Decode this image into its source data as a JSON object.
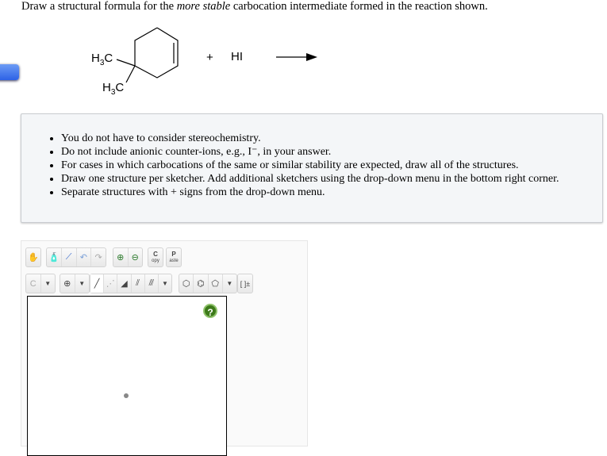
{
  "question": {
    "prefix": "Draw a structural formula for the ",
    "emphasis": "more stable",
    "suffix": " carbocation intermediate formed in the reaction shown."
  },
  "reaction": {
    "label_h3c_1": "H3C",
    "label_h3c_2": "H3C",
    "plus": "+",
    "reagent": "HI"
  },
  "notes": [
    "You do not have to consider stereochemistry.",
    "Do not include anionic counter-ions, e.g., I⁻, in your answer.",
    "For cases in which carbocations of the same or similar stability are expected, draw all of the structures.",
    "Draw one structure per sketcher. Add additional sketchers using the drop-down menu in the bottom right corner.",
    "Separate structures with + signs from the drop-down menu."
  ],
  "sketcher": {
    "copy_label": "C",
    "copy_sub": "opy",
    "paste_label": "P",
    "paste_sub": "aste",
    "atom_label": "C",
    "charge_label": "⊕",
    "bracket_label": "[ ]±",
    "help_label": "?"
  }
}
